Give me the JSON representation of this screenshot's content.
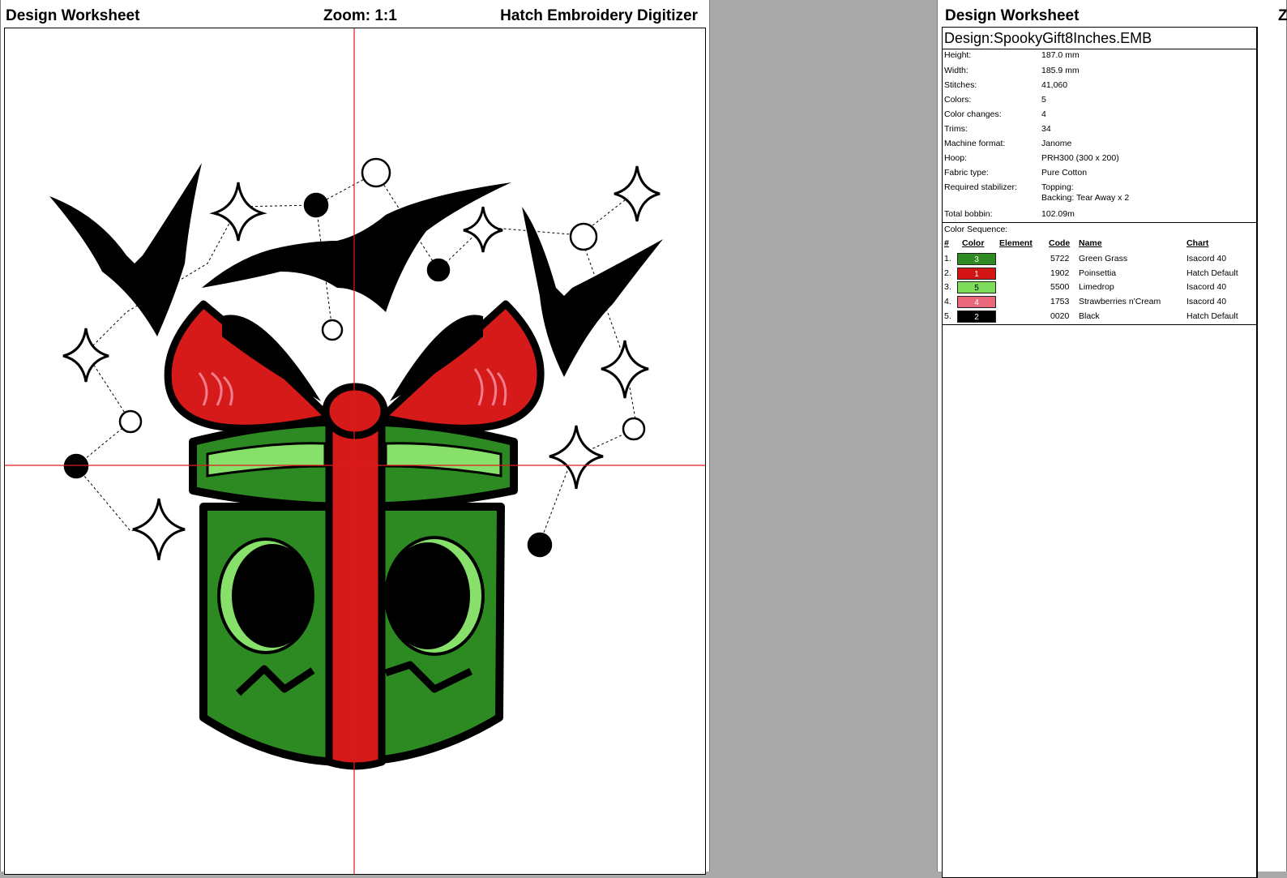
{
  "left_page": {
    "title": "Design Worksheet",
    "zoom_label": "Zoom:",
    "zoom_value": "1:1",
    "app_name": "Hatch Embroidery Digitizer"
  },
  "right_page": {
    "title": "Design Worksheet",
    "zoom_clip": "Z",
    "design_label": "Design:",
    "design_name": "SpookyGift8Inches.EMB",
    "info": [
      {
        "label": "Height:",
        "value": "187.0 mm"
      },
      {
        "label": "Width:",
        "value": "185.9 mm"
      },
      {
        "label": "Stitches:",
        "value": "41,060"
      },
      {
        "label": "Colors:",
        "value": "5"
      },
      {
        "label": "Color changes:",
        "value": "4"
      },
      {
        "label": "Trims:",
        "value": "34"
      },
      {
        "label": "Machine format:",
        "value": "Janome"
      },
      {
        "label": "Hoop:",
        "value": "PRH300 (300 x 200)"
      },
      {
        "label": "Fabric type:",
        "value": "Pure Cotton"
      },
      {
        "label": "Required stabilizer:",
        "value": "Topping:",
        "value2": "Backing: Tear Away x 2"
      },
      {
        "label": "Total bobbin:",
        "value": "102.09m"
      }
    ],
    "color_sequence_label": "Color Sequence:",
    "columns": {
      "num": "#",
      "color": "Color",
      "element": "Element",
      "code": "Code",
      "name": "Name",
      "chart": "Chart"
    },
    "colors": [
      {
        "num": "1.",
        "swatch_num": "3",
        "hex": "#2e8b24",
        "code": "5722",
        "name": "Green Grass",
        "chart": "Isacord 40"
      },
      {
        "num": "2.",
        "swatch_num": "1",
        "hex": "#d21414",
        "code": "1902",
        "name": "Poinsettia",
        "chart": "Hatch Default"
      },
      {
        "num": "3.",
        "swatch_num": "5",
        "hex": "#7ddc5a",
        "code": "5500",
        "name": "Limedrop",
        "chart": "Isacord 40"
      },
      {
        "num": "4.",
        "swatch_num": "4",
        "hex": "#e8677a",
        "code": "1753",
        "name": "Strawberries n'Cream",
        "chart": "Isacord 40"
      },
      {
        "num": "5.",
        "swatch_num": "2",
        "hex": "#000000",
        "code": "0020",
        "name": "Black",
        "chart": "Hatch Default"
      }
    ]
  },
  "design_colors": {
    "green": "#2d8a22",
    "red": "#d61a1a",
    "lime": "#86e06a",
    "pink": "#ef7e8e",
    "black": "#000000",
    "guide": "#e01a1a"
  }
}
